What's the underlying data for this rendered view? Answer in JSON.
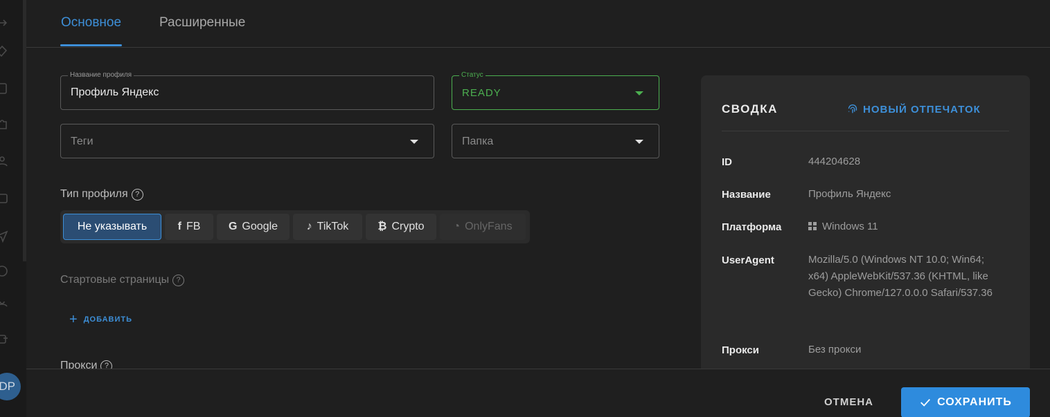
{
  "tabs": {
    "main": "Основное",
    "advanced": "Расширенные"
  },
  "form": {
    "profile_name": {
      "label": "Название профиля",
      "value": "Профиль Яндекс"
    },
    "status": {
      "label": "Статус",
      "value": "READY"
    },
    "tags": {
      "placeholder": "Теги"
    },
    "folder": {
      "placeholder": "Папка"
    },
    "profile_type": {
      "label": "Тип профиля",
      "options": [
        {
          "label": "Не указывать",
          "icon": "none",
          "state": "active"
        },
        {
          "label": "FB",
          "icon": "facebook-icon",
          "glyph": "f",
          "state": "normal"
        },
        {
          "label": "Google",
          "icon": "google-icon",
          "glyph": "G",
          "state": "normal"
        },
        {
          "label": "TikTok",
          "icon": "tiktok-icon",
          "glyph": "♪",
          "state": "normal"
        },
        {
          "label": "Crypto",
          "icon": "bitcoin-icon",
          "glyph": "₿",
          "state": "normal"
        },
        {
          "label": "OnlyFans",
          "icon": "onlyfans-icon",
          "glyph": "◔",
          "state": "disabled"
        }
      ]
    },
    "start_pages": {
      "label": "Стартовые страницы",
      "add_label": "ДОБАВИТЬ"
    },
    "proxy_label": "Прокси"
  },
  "summary": {
    "title": "СВОДКА",
    "new_fingerprint": "НОВЫЙ ОТПЕЧАТОК",
    "rows": [
      {
        "key": "ID",
        "value": "444204628"
      },
      {
        "key": "Название",
        "value": "Профиль Яндекс"
      },
      {
        "key": "Платформа",
        "value": "Windows 11"
      },
      {
        "key": "UserAgent",
        "value": "Mozilla/5.0 (Windows NT 10.0; Win64; x64) AppleWebKit/537.36 (KHTML, like Gecko) Chrome/127.0.0.0 Safari/537.36"
      },
      {
        "key": "Прокси",
        "value": "Без прокси"
      }
    ]
  },
  "footer": {
    "cancel": "ОТМЕНА",
    "save": "СОХРАНИТЬ"
  },
  "user": {
    "initials": "DP"
  },
  "colors": {
    "accent": "#3d8fd8",
    "status_ready": "#4caf50",
    "background": "#1f1f1f",
    "panel": "#2a2a2a"
  }
}
